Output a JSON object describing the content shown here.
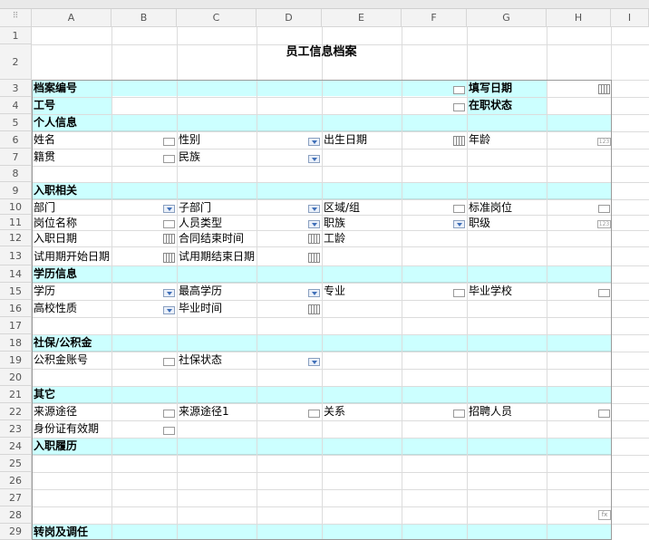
{
  "columns": [
    "A",
    "B",
    "C",
    "D",
    "E",
    "F",
    "G",
    "H",
    "I"
  ],
  "rows": [
    "1",
    "2",
    "3",
    "4",
    "5",
    "6",
    "7",
    "8",
    "9",
    "10",
    "11",
    "12",
    "13",
    "14",
    "15",
    "16",
    "17",
    "18",
    "19",
    "20",
    "21",
    "22",
    "23",
    "24",
    "25",
    "26",
    "27",
    "28",
    "29"
  ],
  "title": "员工信息档案",
  "fields": {
    "archive_no": "档案编号",
    "fill_date": "填写日期",
    "employee_id": "工号",
    "status": "在职状态",
    "name": "姓名",
    "gender": "性别",
    "birth_date": "出生日期",
    "age": "年龄",
    "native_place": "籍贯",
    "ethnicity": "民族",
    "department": "部门",
    "sub_department": "子部门",
    "region_group": "区域/组",
    "standard_post": "标准岗位",
    "post_name": "岗位名称",
    "staff_type": "人员类型",
    "rank": "职族",
    "grade": "职级",
    "hire_date": "入职日期",
    "contract_end": "合同结束时间",
    "seniority": "工龄",
    "probation_start": "试用期开始日期",
    "probation_end": "试用期结束日期",
    "education": "学历",
    "highest_education": "最高学历",
    "major": "专业",
    "school": "毕业学校",
    "school_type": "高校性质",
    "graduation_time": "毕业时间",
    "fund_account": "公积金账号",
    "insurance_status": "社保状态",
    "source": "来源途径",
    "source1": "来源途径1",
    "relation": "关系",
    "recruiter": "招聘人员",
    "id_valid": "身份证有效期"
  },
  "sections": {
    "personal": "个人信息",
    "onboarding": "入职相关",
    "education": "学历信息",
    "insurance": "社保/公积金",
    "other": "其它",
    "resume": "入职履历",
    "transfer": "转岗及调任"
  },
  "icons": {
    "number": "123",
    "formula": "fx"
  },
  "colors": {
    "section_fill": "#ccffff"
  }
}
